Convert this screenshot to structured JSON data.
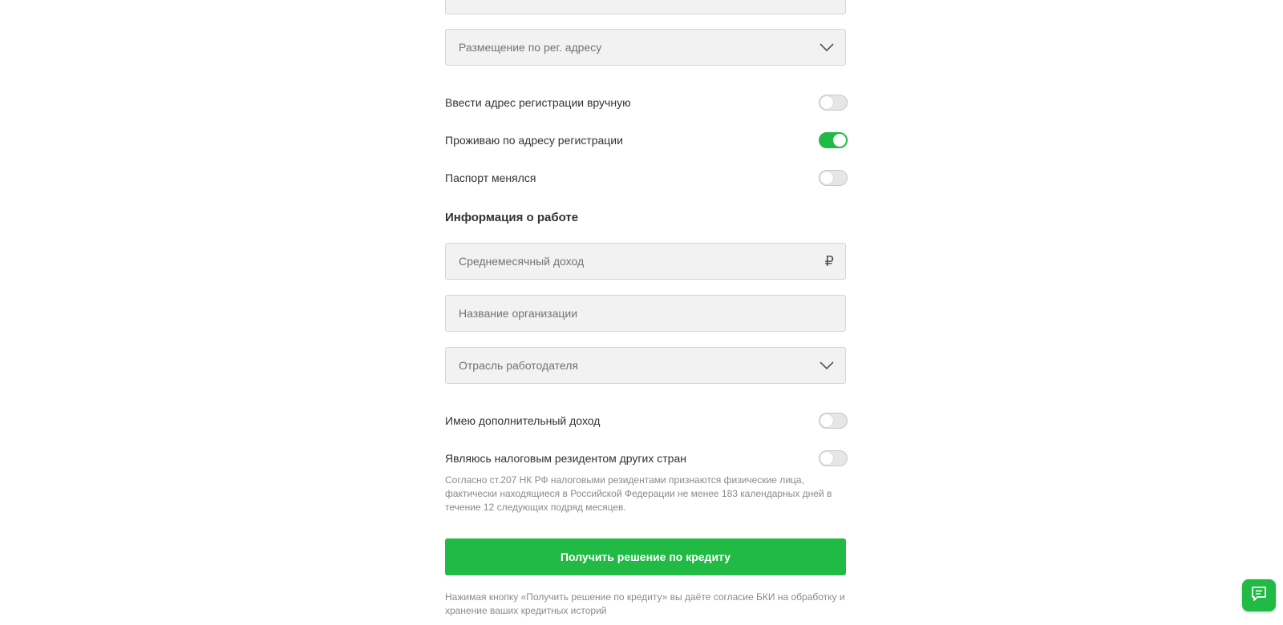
{
  "form": {
    "registration_placement": {
      "placeholder": "Размещение по рег. адресу"
    },
    "toggles": {
      "manual_address": {
        "label": "Ввести адрес регистрации вручную",
        "on": false
      },
      "live_at_registration": {
        "label": "Проживаю по адресу регистрации",
        "on": true
      },
      "passport_changed": {
        "label": "Паспорт менялся",
        "on": false
      }
    },
    "work_section": {
      "title": "Информация о работе",
      "income": {
        "placeholder": "Среднемесячный доход",
        "currency": "₽"
      },
      "organization": {
        "placeholder": "Название организации"
      },
      "industry": {
        "placeholder": "Отрасль работодателя"
      }
    },
    "additional_income": {
      "label": "Имею дополнительный доход",
      "on": false
    },
    "tax_resident": {
      "label": "Являюсь налоговым резидентом других стран",
      "on": false,
      "note": "Согласно ст.207 НК РФ налоговыми резидентами признаются физические лица, фактически находящиеся в Российской Федерации не менее 183 календарных дней в течение 12 следующих подряд месяцев."
    },
    "submit_label": "Получить решение по кредиту",
    "consent_note": "Нажимая кнопку «Получить решение по кредиту» вы даёте согласие БКИ на обработку и хранение ваших кредитных историй"
  },
  "colors": {
    "accent": "#21ba45",
    "field_bg": "#f2f2f2",
    "field_border": "#d5d5d5"
  },
  "icons": {
    "dropdown": "chevron-down-icon",
    "chat": "chat-icon"
  }
}
